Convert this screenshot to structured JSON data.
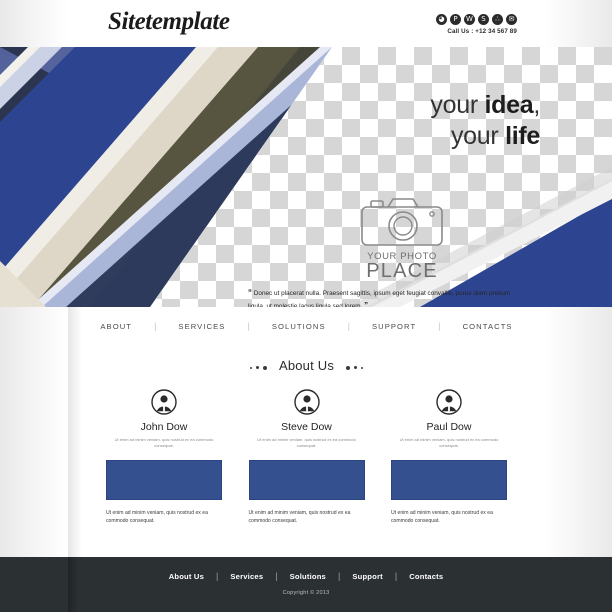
{
  "header": {
    "logo": "Sitetemplate",
    "call_us": "Call Us : +12 34 567 89",
    "social": [
      {
        "name": "dropbox-icon",
        "glyph": "◕"
      },
      {
        "name": "pinterest-icon",
        "glyph": "P"
      },
      {
        "name": "wordpress-icon",
        "glyph": "W"
      },
      {
        "name": "skype-icon",
        "glyph": "S"
      },
      {
        "name": "flickr-icon",
        "glyph": "∴"
      },
      {
        "name": "email-icon",
        "glyph": "✉"
      }
    ]
  },
  "hero": {
    "headline_line1_light": "your ",
    "headline_line1_bold": "idea",
    "headline_line1_tail": ",",
    "headline_line2_light": "your ",
    "headline_line2_bold": "life",
    "photo_label_top": "YOUR PHOTO",
    "photo_label_bottom": "PLACE",
    "quote_open": "“",
    "quote_text": "Donec ut placerat nulla. Praesent sagittis, ipsum eget feugiat convallis, purus diam pretium ligula, ut molestie lacus ligula sed lorem.",
    "quote_close": "”"
  },
  "nav": {
    "items": [
      "ABOUT",
      "SERVICES",
      "SOLUTIONS",
      "SUPPORT",
      "CONTACTS"
    ],
    "separator": "|"
  },
  "section": {
    "title": "About Us"
  },
  "team": {
    "description": "Ut enim ad minim veniam, quis nostrud ex ea commodo consequat.",
    "caption": "Ut enim ad minim veniam, quis nostrud ex ea commodo consequat.",
    "members": [
      {
        "name": "John Dow"
      },
      {
        "name": "Steve Dow"
      },
      {
        "name": "Paul Dow"
      }
    ]
  },
  "footer": {
    "items": [
      "About Us",
      "Services",
      "Solutions",
      "Support",
      "Contacts"
    ],
    "separator": "|",
    "copyright": "Copyright © 2013"
  },
  "colors": {
    "accent_blue": "#34508f",
    "deep_blue": "#2d4490",
    "navy": "#2b3a5e",
    "olive": "#55533f",
    "dark_olive": "#3d3c30",
    "cream": "#e8e2d6",
    "light_blue": "#aab6d8",
    "footer_dark": "#2b3033"
  }
}
